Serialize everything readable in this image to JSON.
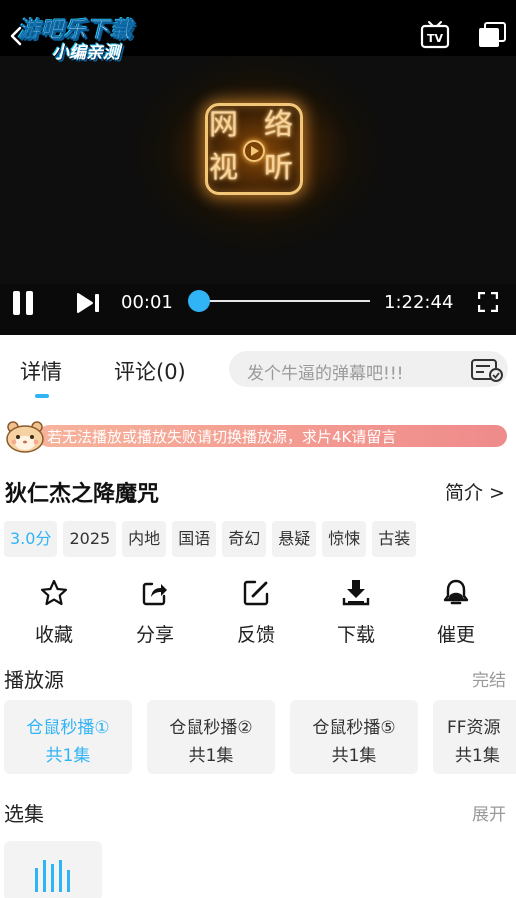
{
  "player": {
    "watermark_line1": "游吧乐下载",
    "watermark_line2": "小编亲测",
    "time_current": "00:01",
    "time_total": "1:22:44",
    "progress": 0.0002,
    "logo_characters": [
      "网",
      "络",
      "视",
      "听"
    ]
  },
  "tabs": {
    "details": "详情",
    "comments": "评论(0)"
  },
  "danmaku": {
    "placeholder": "发个牛逼的弹幕吧!!!"
  },
  "notice": {
    "text": "若无法播放或播放失败请切换播放源，求片4K请留言"
  },
  "movie": {
    "title": "狄仁杰之降魔咒",
    "intro_label": "简介 >",
    "tags": [
      "3.0分",
      "2025",
      "内地",
      "国语",
      "奇幻",
      "悬疑",
      "惊悚",
      "古装"
    ]
  },
  "actions": [
    {
      "label": "收藏",
      "icon": "star-icon"
    },
    {
      "label": "分享",
      "icon": "share-icon"
    },
    {
      "label": "反馈",
      "icon": "feedback-icon"
    },
    {
      "label": "下载",
      "icon": "download-icon"
    },
    {
      "label": "催更",
      "icon": "bell-icon"
    }
  ],
  "sources": {
    "title": "播放源",
    "status": "完结",
    "items": [
      {
        "name": "仓鼠秒播①",
        "count": "共1集",
        "active": true
      },
      {
        "name": "仓鼠秒播②",
        "count": "共1集",
        "active": false
      },
      {
        "name": "仓鼠秒播⑤",
        "count": "共1集",
        "active": false
      },
      {
        "name": "FF资源",
        "count": "共1集",
        "active": false
      }
    ]
  },
  "episodes": {
    "title": "选集",
    "expand_label": "展开"
  },
  "colors": {
    "accent": "#31b4f5",
    "notice_start": "#f6b39b",
    "notice_end": "#ee8b8b",
    "tag_bg": "#f2f2f2"
  }
}
